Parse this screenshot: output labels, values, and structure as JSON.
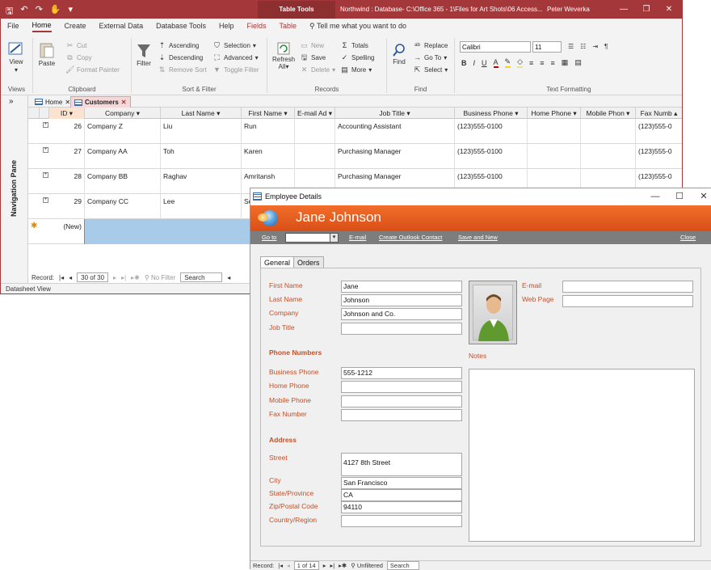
{
  "access": {
    "title_bar": {
      "context_label": "Table Tools",
      "doc_title": "Northwind : Database- C:\\Office 365 - 1\\Files for Art Shots\\06 Access...",
      "user": "Peter Weverka",
      "minimize": "—",
      "restore": "❐",
      "close": "✕"
    },
    "ribbon_tabs": [
      "File",
      "Home",
      "Create",
      "External Data",
      "Database Tools",
      "Help",
      "Fields",
      "Table"
    ],
    "tell_me": "Tell me what you want to do",
    "ribbon": {
      "views": {
        "view_label": "View",
        "group": "Views"
      },
      "clipboard": {
        "paste": "Paste",
        "cut": "Cut",
        "copy": "Copy",
        "format_painter": "Format Painter",
        "group": "Clipboard"
      },
      "sort_filter": {
        "filter": "Filter",
        "ascending": "Ascending",
        "descending": "Descending",
        "remove_sort": "Remove Sort",
        "selection": "Selection",
        "advanced": "Advanced",
        "toggle_filter": "Toggle Filter",
        "group": "Sort & Filter"
      },
      "records": {
        "refresh": "Refresh",
        "refresh_all": "All",
        "new": "New",
        "save": "Save",
        "delete": "Delete",
        "totals": "Totals",
        "spelling": "Spelling",
        "more": "More",
        "group": "Records"
      },
      "find": {
        "find": "Find",
        "replace": "Replace",
        "go_to": "Go To",
        "select": "Select",
        "group": "Find"
      },
      "text_formatting": {
        "font": "Calibri",
        "size": "11",
        "group": "Text Formatting"
      }
    },
    "nav_pane_label": "Navigation Pane",
    "doc_tabs": [
      "Home",
      "Customers"
    ],
    "columns": [
      "ID",
      "Company",
      "Last Name",
      "First Name",
      "E-mail Ad",
      "Job Title",
      "Business Phone",
      "Home Phone",
      "Mobile Phon",
      "Fax Numb"
    ],
    "rows": [
      {
        "id": "26",
        "company": "Company Z",
        "last": "Liu",
        "first": "Run",
        "job": "Accounting Assistant",
        "bphone": "(123)555-0100",
        "fax": "(123)555-0"
      },
      {
        "id": "27",
        "company": "Company AA",
        "last": "Toh",
        "first": "Karen",
        "job": "Purchasing Manager",
        "bphone": "(123)555-0100",
        "fax": "(123)555-0"
      },
      {
        "id": "28",
        "company": "Company BB",
        "last": "Raghav",
        "first": "Amritansh",
        "job": "Purchasing Manager",
        "bphone": "(123)555-0100",
        "fax": "(123)555-0"
      },
      {
        "id": "29",
        "company": "Company CC",
        "last": "Lee",
        "first": "So",
        "job": "",
        "bphone": "",
        "fax": ""
      }
    ],
    "new_row_label": "(New)",
    "record_nav": {
      "label": "Record:",
      "position": "30 of 30",
      "filter": "No Filter",
      "search": "Search"
    },
    "status": "Datasheet View"
  },
  "employee": {
    "window_title": "Employee Details",
    "name": "Jane Johnson",
    "toolbar": {
      "goto": "Go to",
      "email": "E-mail",
      "outlook": "Create Outlook Contact",
      "save_new": "Save and New",
      "close": "Close"
    },
    "tabs": [
      "General",
      "Orders"
    ],
    "fields": {
      "first_name_label": "First Name",
      "first_name": "Jane",
      "last_name_label": "Last Name",
      "last_name": "Johnson",
      "company_label": "Company",
      "company": "Johnson and Co.",
      "job_title_label": "Job Title",
      "job_title": "",
      "email_label": "E-mail",
      "email": "",
      "web_label": "Web Page",
      "web": "",
      "phone_section": "Phone Numbers",
      "business_phone_label": "Business Phone",
      "business_phone": "555-1212",
      "home_phone_label": "Home Phone",
      "home_phone": "",
      "mobile_phone_label": "Mobile Phone",
      "mobile_phone": "",
      "fax_label": "Fax Number",
      "fax": "",
      "address_section": "Address",
      "street_label": "Street",
      "street": "4127 8th Street",
      "city_label": "City",
      "city": "San Francisco",
      "state_label": "State/Province",
      "state": "CA",
      "zip_label": "Zip/Postal Code",
      "zip": "94110",
      "country_label": "Country/Region",
      "country": "",
      "notes_label": "Notes"
    },
    "record_nav": {
      "label": "Record:",
      "position": "1 of 14",
      "filter": "Unfiltered",
      "search": "Search"
    }
  }
}
